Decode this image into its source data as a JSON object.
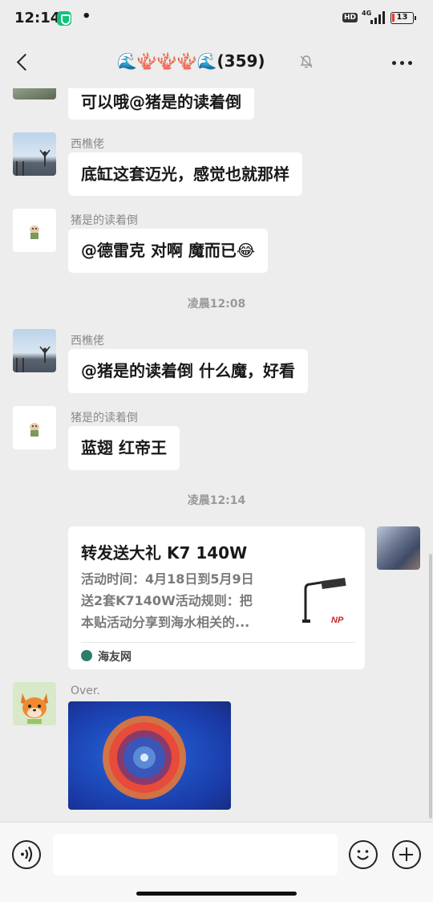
{
  "status_bar": {
    "time": "12:14",
    "dot": "•",
    "hd_label": "HD",
    "network": "4G",
    "battery": "13"
  },
  "chat_header": {
    "title": "🌊🪸🪸🪸🌊(359)",
    "muted_icon": "bell-off-icon"
  },
  "messages": [
    {
      "sender": "",
      "text": "可以哦@猪是的读着倒"
    },
    {
      "sender": "西樵佬",
      "text": "底缸这套迈光，感觉也就那样"
    },
    {
      "sender": "猪是的读着倒",
      "text": "@德雷克  对啊 魔而已😂"
    },
    {
      "timestamp": "凌晨12:08"
    },
    {
      "sender": "西樵佬",
      "text": "@猪是的读着倒  什么魔，好看"
    },
    {
      "sender": "猪是的读着倒",
      "text": "蓝翅 红帝王"
    },
    {
      "timestamp": "凌晨12:14"
    }
  ],
  "link_card": {
    "title": "转发送大礼 K7 140W",
    "description_lines": [
      "活动时间：4月18日到5月9日",
      "送2套K7140W活动规则：把",
      "本贴活动分享到海水相关的..."
    ],
    "thumb_brand": "NP",
    "source": "海友网"
  },
  "image_message": {
    "sender": "Over."
  },
  "colors": {
    "background": "#ededed",
    "bubble": "#ffffff",
    "source_icon": "#2e7d6b"
  }
}
